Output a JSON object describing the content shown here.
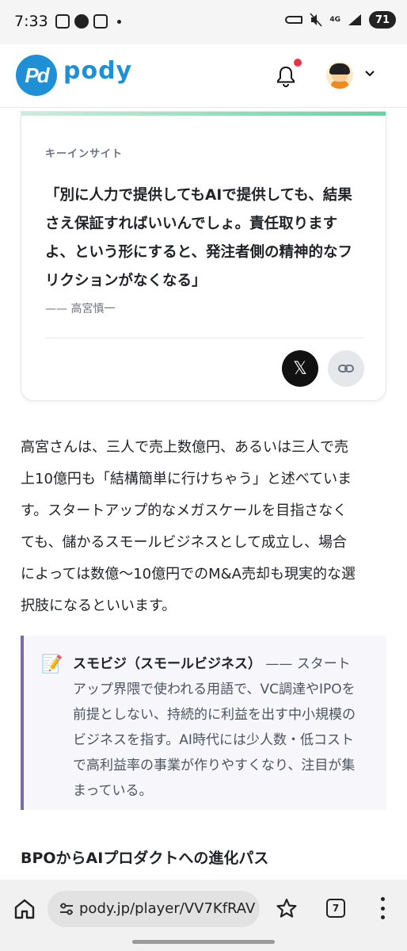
{
  "status_bar": {
    "time": "7:33",
    "network": "4G",
    "battery": "71"
  },
  "header": {
    "logo_mark": "Pd",
    "logo_text": "pody",
    "icons": [
      "bell-icon",
      "avatar",
      "chevron-down-icon"
    ],
    "notification_dot_color": "#e8344a"
  },
  "insight": {
    "label": "キーインサイト",
    "quote_lines": [
      "「別に人力で提供してもAIで提供しても、結果",
      "さえ保証すればいいんでしょ。責任取ります",
      "よ、という形にすると、発注者側の精神的なフ",
      "リクションがなくなる」"
    ],
    "author": "—— 高宮慎一",
    "share_x": "𝕏",
    "accent_color": "#5fd6a0"
  },
  "article": {
    "paragraph_lines": [
      "高宮さんは、三人で売上数億円、あるいは三人で売",
      "上10億円も「結構簡単に行けちゃう」と述べていま",
      "す。スタートアップ的なメガスケールを目指さなく",
      "ても、儲かるスモールビジネスとして成立し、場合",
      "によっては数億〜10億円でのM&A売却も現実的な選",
      "択肢になるといいます。"
    ],
    "term": {
      "icon": "📝",
      "title": "スモビジ（スモールビジネス）",
      "first_line_rest": " —— スタート",
      "lines": [
        "アップ界隈で使われる用語で、VC調達やIPOを",
        "前提としない、持続的に利益を出す中小規模の",
        "ビジネスを指す。AI時代には少人数・低コスト",
        "で高利益率の事業が作りやすくなり、注目が集",
        "まっている。"
      ]
    },
    "section_heading": "BPOからAIプロダクトへの進化パス"
  },
  "browser": {
    "url": "pody.jp/player/VV7KfRAV",
    "tab_count": "7",
    "icons": [
      "home-icon",
      "tune-icon",
      "star-icon",
      "tabs-icon",
      "more-vert-icon"
    ]
  }
}
